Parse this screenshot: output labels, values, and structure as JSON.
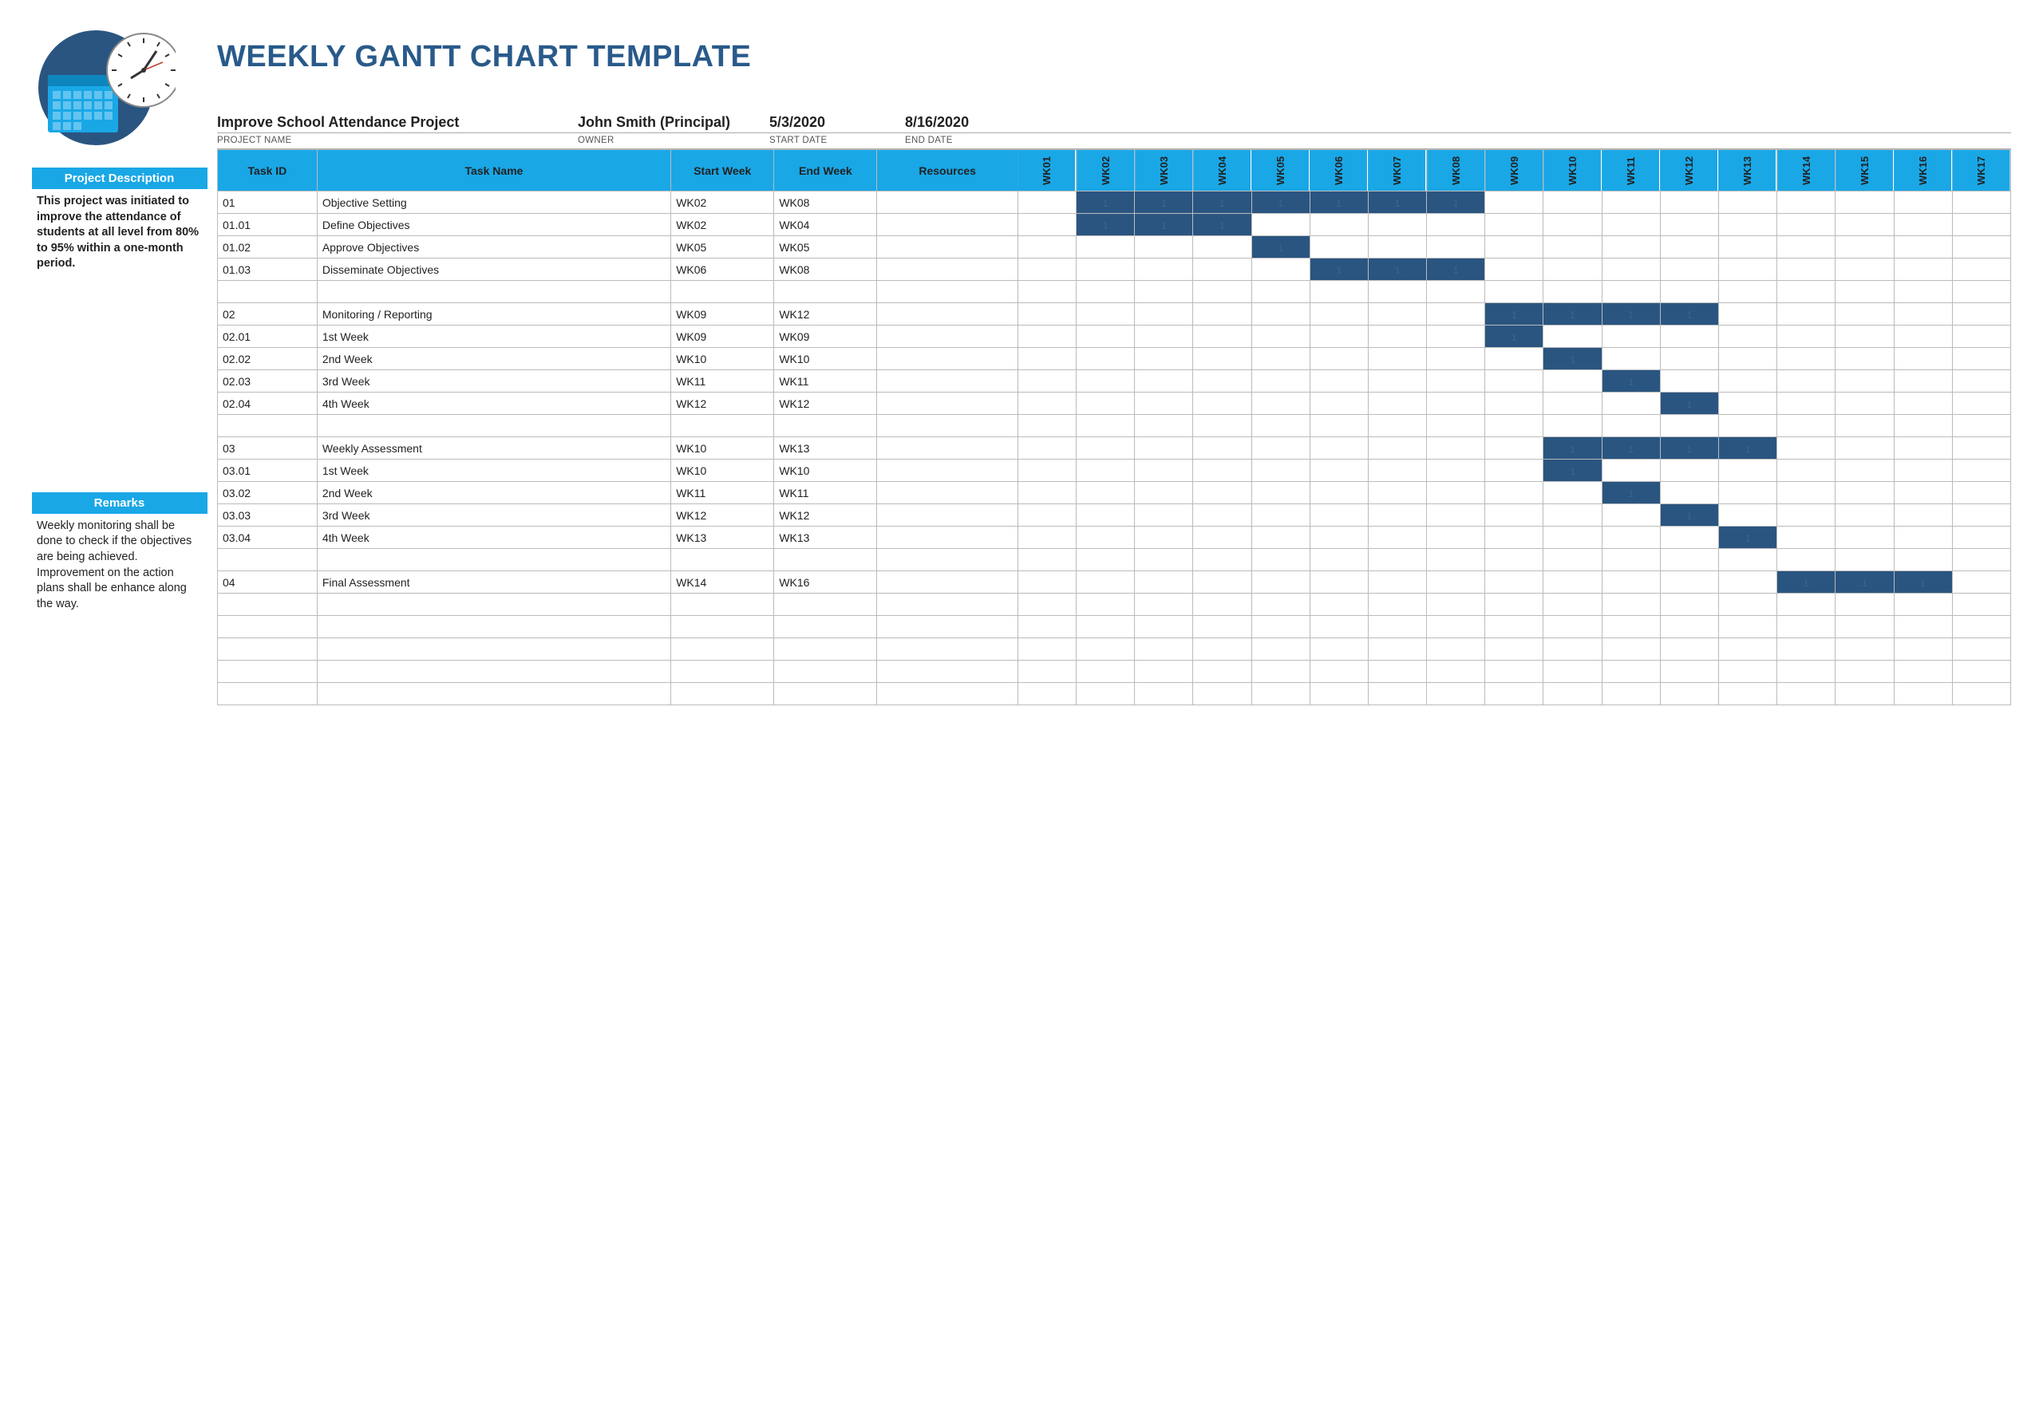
{
  "title": "WEEKLY GANTT CHART TEMPLATE",
  "meta": {
    "project_name": {
      "value": "Improve School Attendance Project",
      "label": "PROJECT NAME"
    },
    "owner": {
      "value": "John Smith (Principal)",
      "label": "OWNER"
    },
    "start_date": {
      "value": "5/3/2020",
      "label": "START DATE"
    },
    "end_date": {
      "value": "8/16/2020",
      "label": "END DATE"
    }
  },
  "sidebar": {
    "description": {
      "title": "Project Description",
      "body": "This project was initiated to improve the attendance of students at all level from 80% to 95% within a one-month period."
    },
    "remarks": {
      "title": "Remarks",
      "body": "Weekly monitoring shall be done to check if the objectives are being achieved.\nImprovement on the action plans shall be enhance along the way."
    }
  },
  "headers": {
    "task_id": "Task ID",
    "task_name": "Task Name",
    "start_week": "Start Week",
    "end_week": "End Week",
    "resources": "Resources"
  },
  "weeks": [
    "WK01",
    "WK02",
    "WK03",
    "WK04",
    "WK05",
    "WK06",
    "WK07",
    "WK08",
    "WK09",
    "WK10",
    "WK11",
    "WK12",
    "WK13",
    "WK14",
    "WK15",
    "WK16",
    "WK17"
  ],
  "chart_data": {
    "type": "bar",
    "title": "Weekly Gantt Chart",
    "timeline_weeks": [
      "WK01",
      "WK02",
      "WK03",
      "WK04",
      "WK05",
      "WK06",
      "WK07",
      "WK08",
      "WK09",
      "WK10",
      "WK11",
      "WK12",
      "WK13",
      "WK14",
      "WK15",
      "WK16",
      "WK17"
    ],
    "tasks": [
      {
        "id": "01",
        "name": "Objective Setting",
        "start": "WK02",
        "end": "WK08",
        "resources": ""
      },
      {
        "id": "01.01",
        "name": "Define Objectives",
        "start": "WK02",
        "end": "WK04",
        "resources": ""
      },
      {
        "id": "01.02",
        "name": "Approve Objectives",
        "start": "WK05",
        "end": "WK05",
        "resources": ""
      },
      {
        "id": "01.03",
        "name": "Disseminate Objectives",
        "start": "WK06",
        "end": "WK08",
        "resources": ""
      },
      {
        "id": "",
        "name": "",
        "start": "",
        "end": "",
        "resources": ""
      },
      {
        "id": "02",
        "name": "Monitoring / Reporting",
        "start": "WK09",
        "end": "WK12",
        "resources": ""
      },
      {
        "id": "02.01",
        "name": "1st Week",
        "start": "WK09",
        "end": "WK09",
        "resources": ""
      },
      {
        "id": "02.02",
        "name": "2nd Week",
        "start": "WK10",
        "end": "WK10",
        "resources": ""
      },
      {
        "id": "02.03",
        "name": "3rd Week",
        "start": "WK11",
        "end": "WK11",
        "resources": ""
      },
      {
        "id": "02.04",
        "name": "4th Week",
        "start": "WK12",
        "end": "WK12",
        "resources": ""
      },
      {
        "id": "",
        "name": "",
        "start": "",
        "end": "",
        "resources": ""
      },
      {
        "id": "03",
        "name": "Weekly Assessment",
        "start": "WK10",
        "end": "WK13",
        "resources": ""
      },
      {
        "id": "03.01",
        "name": "1st Week",
        "start": "WK10",
        "end": "WK10",
        "resources": ""
      },
      {
        "id": "03.02",
        "name": "2nd Week",
        "start": "WK11",
        "end": "WK11",
        "resources": ""
      },
      {
        "id": "03.03",
        "name": "3rd Week",
        "start": "WK12",
        "end": "WK12",
        "resources": ""
      },
      {
        "id": "03.04",
        "name": "4th Week",
        "start": "WK13",
        "end": "WK13",
        "resources": ""
      },
      {
        "id": "",
        "name": "",
        "start": "",
        "end": "",
        "resources": ""
      },
      {
        "id": "04",
        "name": "Final Assessment",
        "start": "WK14",
        "end": "WK16",
        "resources": ""
      },
      {
        "id": "",
        "name": "",
        "start": "",
        "end": "",
        "resources": ""
      },
      {
        "id": "",
        "name": "",
        "start": "",
        "end": "",
        "resources": ""
      },
      {
        "id": "",
        "name": "",
        "start": "",
        "end": "",
        "resources": ""
      },
      {
        "id": "",
        "name": "",
        "start": "",
        "end": "",
        "resources": ""
      },
      {
        "id": "",
        "name": "",
        "start": "",
        "end": "",
        "resources": ""
      }
    ],
    "cell_marker": "1"
  }
}
